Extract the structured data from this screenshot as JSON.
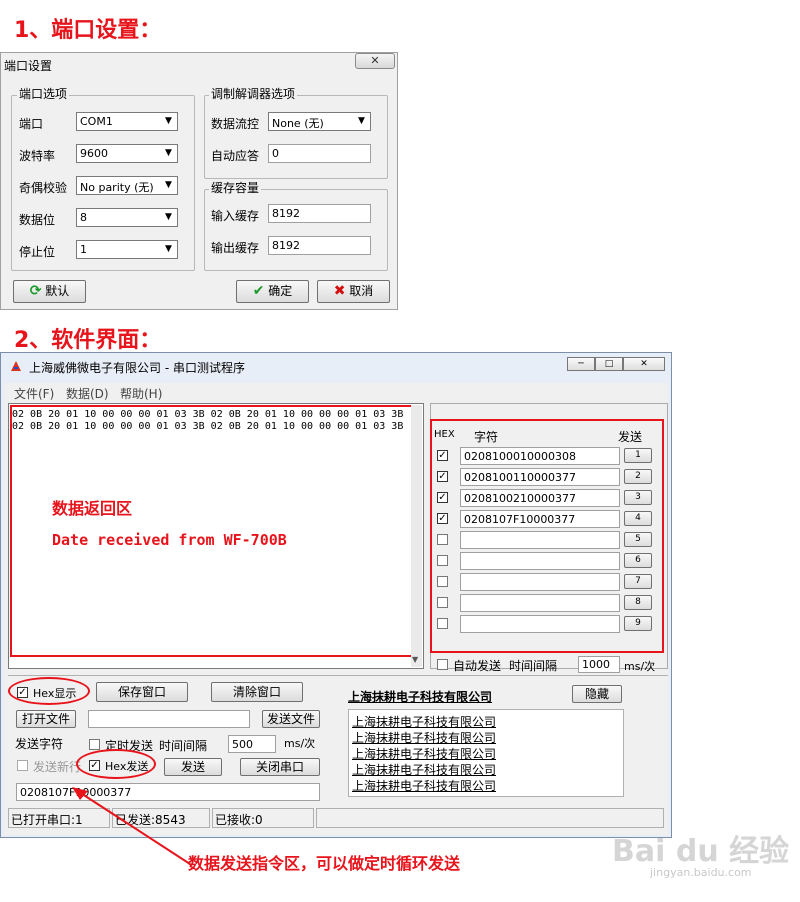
{
  "headings": {
    "port_settings": "1、端口设置：",
    "software_ui": "2、软件界面："
  },
  "port_dialog": {
    "title": "端口设置",
    "close_glyph": "✕",
    "port_options": {
      "label": "端口选项",
      "port_label": "端口",
      "port_value": "COM1",
      "baud_label": "波特率",
      "baud_value": "9600",
      "parity_label": "奇偶校验",
      "parity_value": "No parity (无)",
      "databits_label": "数据位",
      "databits_value": "8",
      "stopbits_label": "停止位",
      "stopbits_value": "1"
    },
    "modem_options": {
      "label": "调制解调器选项",
      "flow_label": "数据流控",
      "flow_value": "None (无)",
      "auto_answer_label": "自动应答",
      "auto_answer_value": "0"
    },
    "buffer": {
      "label": "缓存容量",
      "input_label": "输入缓存",
      "input_value": "8192",
      "output_label": "输出缓存",
      "output_value": "8192"
    },
    "default_button": "默认",
    "ok_button": "确定",
    "cancel_button": "取消"
  },
  "main_window": {
    "title": "上海威佛微电子有限公司 - 串口测试程序",
    "menu": [
      "文件(F)",
      "数据(D)",
      "帮助(H)"
    ],
    "received_lines": [
      "02 0B 20 01 10 00 00 00 01 03 3B 02 0B 20 01 10 00 00 00 01 03 3B",
      "02 0B 20 01 10 00 00 00 01 03 3B 02 0B 20 01 10 00 00 00 01 03 3B"
    ],
    "recv_label": "数据返回区",
    "recv_caption": "Date received from WF-700B",
    "send_table": {
      "hex_header": "HEX",
      "char_header": "字符",
      "send_header": "发送",
      "rows": [
        {
          "checked": true,
          "value": "0208100010000308",
          "button": "1"
        },
        {
          "checked": true,
          "value": "0208100110000377",
          "button": "2"
        },
        {
          "checked": true,
          "value": "0208100210000377",
          "button": "3"
        },
        {
          "checked": true,
          "value": "0208107F10000377",
          "button": "4"
        },
        {
          "checked": false,
          "value": "",
          "button": "5"
        },
        {
          "checked": false,
          "value": "",
          "button": "6"
        },
        {
          "checked": false,
          "value": "",
          "button": "7"
        },
        {
          "checked": false,
          "value": "",
          "button": "8"
        },
        {
          "checked": false,
          "value": "",
          "button": "9"
        }
      ]
    },
    "auto_send_label": "自动发送",
    "auto_interval_label": "时间间隔",
    "auto_interval_value": "1000",
    "auto_interval_unit": "ms/次",
    "hex_display_label": "Hex显示",
    "save_window_button": "保存窗口",
    "clear_window_button": "清除窗口",
    "open_file_button": "打开文件",
    "send_file_button": "发送文件",
    "send_chars_label": "发送字符",
    "timed_send_label": "定时发送",
    "interval_label": "时间间隔",
    "interval_value": "500",
    "interval_unit": "ms/次",
    "send_newline_label": "发送新行",
    "hex_send_label": "Hex发送",
    "send_button": "发送",
    "close_port_button": "关闭串口",
    "send_input_value": "0208107F10000377",
    "company_link": "上海抹耕电子科技有限公司",
    "hide_button": "隐藏",
    "company_list": [
      "上海抹耕电子科技有限公司",
      "上海抹耕电子科技有限公司",
      "上海抹耕电子科技有限公司",
      "上海抹耕电子科技有限公司",
      "上海抹耕电子科技有限公司"
    ],
    "status": {
      "port_open": "已打开串口:1",
      "sent": "已发送:8543",
      "received": "已接收:0"
    }
  },
  "annotation": {
    "send_area_note": "数据发送指令区，可以做定时循环发送"
  },
  "watermark": {
    "brand": "Bai du 经验",
    "url": "jingyan.baidu.com"
  },
  "colors": {
    "annotation_red": "#e8141b",
    "dialog_bg": "#f0f0f0"
  }
}
